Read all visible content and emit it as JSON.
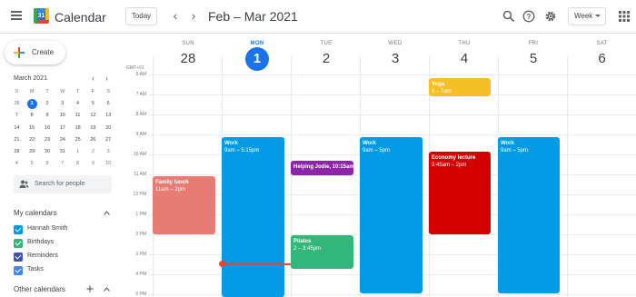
{
  "app": {
    "title": "Calendar",
    "logo_day": "31"
  },
  "header": {
    "today_label": "Today",
    "prev_label": "‹",
    "next_label": "›",
    "date_range": "Feb – Mar 2021",
    "view_label": "Week"
  },
  "create": {
    "label": "Create"
  },
  "mini_calendar": {
    "month": "March 2021",
    "prev": "‹",
    "next": "›",
    "dow": [
      "S",
      "M",
      "T",
      "W",
      "T",
      "F",
      "S"
    ],
    "weeks": [
      [
        "28",
        "1",
        "2",
        "3",
        "4",
        "5",
        "6"
      ],
      [
        "7",
        "8",
        "9",
        "10",
        "11",
        "12",
        "13"
      ],
      [
        "14",
        "15",
        "16",
        "17",
        "18",
        "19",
        "20"
      ],
      [
        "21",
        "22",
        "23",
        "24",
        "25",
        "26",
        "27"
      ],
      [
        "28",
        "29",
        "30",
        "31",
        "1",
        "2",
        "3"
      ],
      [
        "4",
        "5",
        "6",
        "7",
        "8",
        "9",
        "10"
      ]
    ]
  },
  "search_people": {
    "placeholder": "Search for people"
  },
  "my_calendars": {
    "title": "My calendars",
    "items": [
      {
        "name": "Hannah Smith",
        "color": "#039be5"
      },
      {
        "name": "Birthdays",
        "color": "#33b679"
      },
      {
        "name": "Reminders",
        "color": "#3f51b5"
      },
      {
        "name": "Tasks",
        "color": "#4285f4"
      }
    ]
  },
  "other_calendars": {
    "title": "Other calendars"
  },
  "timezone": "GMT+01",
  "days": [
    {
      "dow": "SUN",
      "num": "28"
    },
    {
      "dow": "MON",
      "num": "1"
    },
    {
      "dow": "TUE",
      "num": "2"
    },
    {
      "dow": "WED",
      "num": "3"
    },
    {
      "dow": "THU",
      "num": "4"
    },
    {
      "dow": "FRI",
      "num": "5"
    },
    {
      "dow": "SAT",
      "num": "6"
    }
  ],
  "times": [
    "6 AM",
    "7 AM",
    "8 AM",
    "9 AM",
    "10 AM",
    "11 AM",
    "12 PM",
    "1 PM",
    "2 PM",
    "3 PM",
    "4 PM",
    "5 PM"
  ],
  "events": [
    {
      "title": "Yoga",
      "time": "6 – 7am",
      "color": "#f6bf26"
    },
    {
      "title": "Work",
      "time": "9am – 5:15pm",
      "color": "#039be5"
    },
    {
      "title": "Helping Jodie, 10:15am",
      "time": "",
      "color": "#8e24aa"
    },
    {
      "title": "Work",
      "time": "9am – 5pm",
      "color": "#039be5"
    },
    {
      "title": "Economy lecture",
      "time": "9:45am – 2pm",
      "color": "#d50000"
    },
    {
      "title": "Work",
      "time": "9am – 5pm",
      "color": "#039be5"
    },
    {
      "title": "Family lunch",
      "time": "11am – 2pm",
      "color": "#e67c73"
    },
    {
      "title": "Pilates",
      "time": "2 – 3:45pm",
      "color": "#33b679"
    }
  ]
}
